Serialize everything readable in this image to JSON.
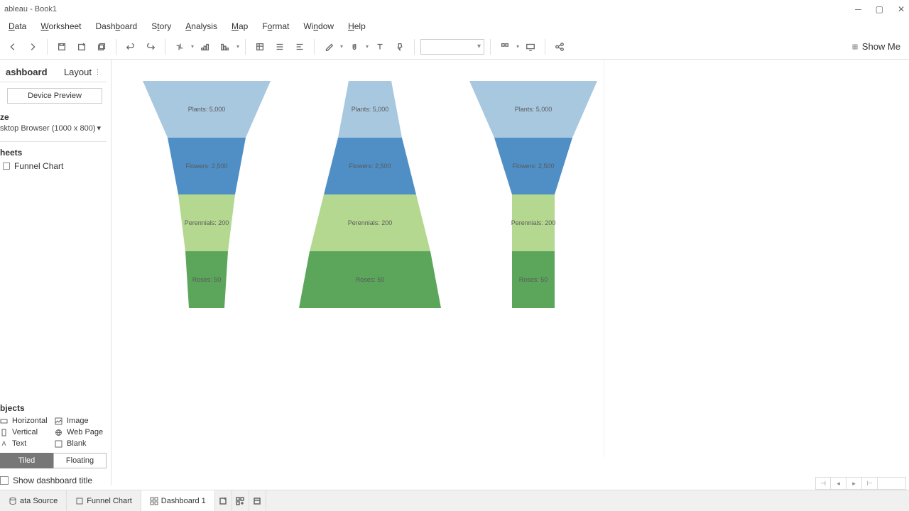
{
  "window": {
    "title": "ableau - Book1"
  },
  "menu": {
    "data": "Data",
    "worksheet": "Worksheet",
    "dashboard": "Dashboard",
    "story": "Story",
    "analysis": "Analysis",
    "map": "Map",
    "format": "Format",
    "window": "Window",
    "help": "Help"
  },
  "toolbar": {
    "showme": "Show Me"
  },
  "sidebar": {
    "tab_dashboard": "ashboard",
    "tab_layout": "Layout",
    "device_preview": "Device Preview",
    "size_label": "ze",
    "size_value": "sktop Browser (1000 x 800)",
    "sheets_label": "heets",
    "sheet1": "Funnel Chart",
    "objects_label": "bjects",
    "obj_horizontal": "Horizontal",
    "obj_vertical": "Vertical",
    "obj_text": "Text",
    "obj_image": "Image",
    "obj_webpage": "Web Page",
    "obj_blank": "Blank",
    "tiled": "Tiled",
    "floating": "Floating",
    "show_title": "Show dashboard title"
  },
  "tabs": {
    "data_source": "ata Source",
    "funnel_chart": "Funnel Chart",
    "dashboard1": "Dashboard 1"
  },
  "chart_data": [
    {
      "type": "funnel",
      "shape": "tapered",
      "stages": [
        {
          "label": "Plants",
          "value": 5000,
          "text": "Plants: 5,000",
          "color": "#a8c8e0"
        },
        {
          "label": "Flowers",
          "value": 2500,
          "text": "Flowers: 2,500",
          "color": "#4f8fc5"
        },
        {
          "label": "Perennials",
          "value": 200,
          "text": "Perennials: 200",
          "color": "#b4d88f"
        },
        {
          "label": "Roses",
          "value": 50,
          "text": "Roses: 50",
          "color": "#5ca65c"
        }
      ]
    },
    {
      "type": "funnel",
      "shape": "cone",
      "stages": [
        {
          "label": "Plants",
          "value": 5000,
          "text": "Plants: 5,000",
          "color": "#a8c8e0"
        },
        {
          "label": "Flowers",
          "value": 2500,
          "text": "Flowers: 2,500",
          "color": "#4f8fc5"
        },
        {
          "label": "Perennials",
          "value": 200,
          "text": "Perennials: 200",
          "color": "#b4d88f"
        },
        {
          "label": "Roses",
          "value": 50,
          "text": "Roses: 50",
          "color": "#5ca65c"
        }
      ]
    },
    {
      "type": "funnel",
      "shape": "stem",
      "stages": [
        {
          "label": "Plants",
          "value": 5000,
          "text": "Plants: 5,000",
          "color": "#a8c8e0"
        },
        {
          "label": "Flowers",
          "value": 2500,
          "text": "Flowers: 2,500",
          "color": "#4f8fc5"
        },
        {
          "label": "Perennials",
          "value": 200,
          "text": "Perennials: 200",
          "color": "#b4d88f"
        },
        {
          "label": "Roses",
          "value": 50,
          "text": "Roses: 50",
          "color": "#5ca65c"
        }
      ]
    }
  ]
}
